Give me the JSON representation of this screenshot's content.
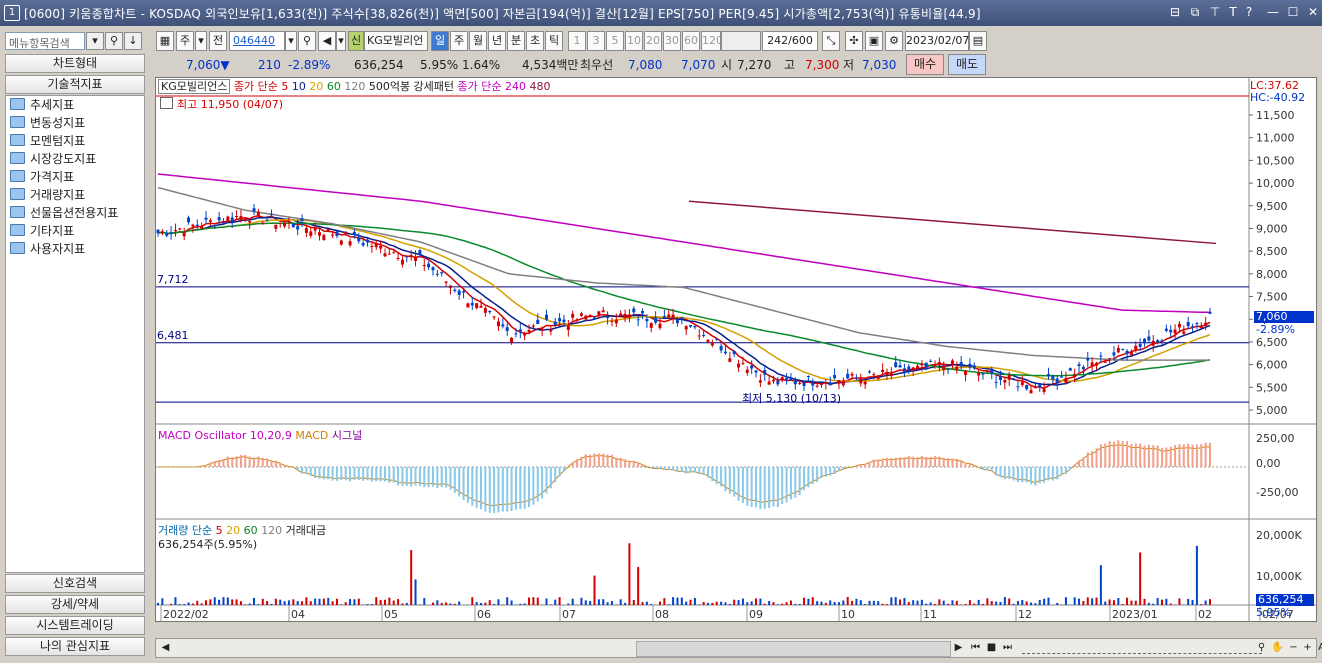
{
  "window": {
    "number": "1",
    "title": "[0600] 키움종합차트 - KOSDAQ 외국인보유[1,633(천)] 주식수[38,826(천)] 액면[500] 자본금[194(억)] 결산[12월] EPS[750] PER[9.45] 시가총액[2,753(억)] 유통비율[44.9]",
    "controls": [
      "⊟",
      "⧉",
      "⊤",
      "T",
      "?",
      "—",
      "☐",
      "✕"
    ]
  },
  "left_panel": {
    "search_placeholder": "메뉴항목검색",
    "buttons": [
      "차트형태",
      "기술적지표"
    ],
    "tree": [
      "추세지표",
      "변동성지표",
      "모멘텀지표",
      "시장강도지표",
      "가격지표",
      "거래량지표",
      "선물옵션전용지표",
      "기타지표",
      "사용자지표"
    ],
    "bottom_buttons": [
      "신호검색",
      "강세/약세",
      "시스템트레이딩",
      "나의 관심지표"
    ]
  },
  "toolbar": {
    "period": "주",
    "prev": "전",
    "code": "046440",
    "sin_label": "신",
    "stock_name": "KG모빌리언",
    "intervals": [
      "일",
      "주",
      "월",
      "년",
      "분",
      "초",
      "틱"
    ],
    "minutes": [
      "1",
      "3",
      "5",
      "10",
      "20",
      "30",
      "60",
      "120"
    ],
    "count": "242/600",
    "date": "2023/02/07"
  },
  "quote": {
    "price": "7,060",
    "arrow": "▼",
    "change": "210",
    "change_pct": "-2.89%",
    "volume": "636,254",
    "vol_pct": "5.95%",
    "turnover": "1.64%",
    "amount": "4,534백만",
    "best_label": "최우선",
    "ask": "7,080",
    "bid": "7,070",
    "open_label": "시",
    "open": "7,270",
    "high_label": "고",
    "high": "7,300",
    "low_label": "저",
    "low": "7,030",
    "buy": "매수",
    "sell": "매도"
  },
  "price_pane": {
    "legend_name": "KG모빌리언스",
    "legend_ma": "종가 단순",
    "ma_periods": [
      "5",
      "10",
      "20",
      "60",
      "120"
    ],
    "pattern": "500억봉 강세패턴",
    "legend_ma2": "종가 단순",
    "ma2_periods": [
      "240",
      "480"
    ],
    "high_note": "최고 11,950 (04/07)",
    "low_note": "최저 5,130 (10/13)",
    "line_7712": "7,712",
    "line_6481": "6,481",
    "lc": "LC:37.62",
    "hc": "HC:-40.92",
    "yticks": [
      "11,500",
      "11,000",
      "10,500",
      "10,000",
      "9,500",
      "9,000",
      "8,500",
      "8,000",
      "7,500",
      "7,000",
      "6,500",
      "6,000",
      "5,500",
      "5,000"
    ],
    "cur_price": "7,060",
    "cur_pct": "-2.89%"
  },
  "macd_pane": {
    "legend": "MACD Oscillator 10,20,9",
    "macd": "MACD",
    "signal": "시그널",
    "yticks": [
      "250,00",
      "0,00",
      "-250,00"
    ]
  },
  "volume_pane": {
    "legend": "거래량 단순",
    "periods": [
      "5",
      "20",
      "60",
      "120"
    ],
    "amount": "거래대금",
    "value": "636,254주(5.95%)",
    "yticks": [
      "20,000K",
      "10,000K"
    ],
    "cur": "636,254",
    "cur_pct": "5.95%"
  },
  "x_axis": [
    "2022/02",
    "04",
    "05",
    "06",
    "07",
    "08",
    "09",
    "10",
    "11",
    "12",
    "2023/01",
    "02",
    "02/07"
  ],
  "colors": {
    "ma5": "#d40000",
    "ma10": "#0a1e8c",
    "ma20": "#d4a000",
    "ma60": "#0a8a2a",
    "ma120": "#808080",
    "ma240": "#c000c0",
    "ma480": "#8b1a3a",
    "up": "#d40000",
    "down": "#0044cc"
  },
  "chart_data": {
    "type": "line",
    "title": "KG모빌리언스",
    "x": [
      "2022/02",
      "2022/04",
      "2022/05",
      "2022/06",
      "2022/07",
      "2022/08",
      "2022/09",
      "2022/10",
      "2022/11",
      "2022/12",
      "2023/01",
      "2023/02",
      "2023/02/07"
    ],
    "series": [
      {
        "name": "종가",
        "values": [
          8900,
          9300,
          8900,
          8300,
          6700,
          7100,
          7000,
          5600,
          5700,
          6000,
          5500,
          6300,
          7060
        ]
      },
      {
        "name": "120",
        "values": [
          9900,
          9400,
          9100,
          8700,
          8000,
          7800,
          7700,
          7200,
          6700,
          6400,
          6200,
          6100,
          6100
        ]
      },
      {
        "name": "240",
        "values": [
          10200,
          10000,
          9800,
          9600,
          9300,
          9000,
          8700,
          8400,
          8100,
          7800,
          7500,
          7200,
          7150
        ]
      }
    ],
    "ylim": [
      5000,
      12000
    ]
  }
}
